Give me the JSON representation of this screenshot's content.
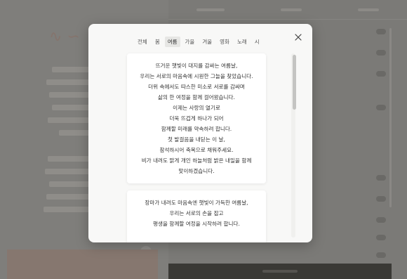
{
  "modal": {
    "tabs": [
      {
        "label": "전체",
        "active": false
      },
      {
        "label": "봄",
        "active": false
      },
      {
        "label": "여름",
        "active": true
      },
      {
        "label": "가을",
        "active": false
      },
      {
        "label": "겨울",
        "active": false
      },
      {
        "label": "영화",
        "active": false
      },
      {
        "label": "노래",
        "active": false
      },
      {
        "label": "시",
        "active": false
      }
    ],
    "cards": [
      {
        "lines": [
          "뜨거운 햇빛이 대지를 감싸는 여름날,",
          "우리는 서로의 마음속에 시원한 그늘을 찾았습니다.",
          "더위 속에서도 따스한 미소로 서로를 감싸며",
          "삶의 한 여정을 함께 걸어왔습니다.",
          "이제는 사랑의 열기로",
          "더욱 뜨겁게 하나가 되어",
          "함께할 미래를 약속하려 합니다.",
          "첫 발걸음을 내딛는 이 날,",
          "참석하시어 축복으로 채워주세요.",
          "비가 내려도 맑게 개인 하늘처럼 밝은 내일을 함께",
          "맞이하겠습니다."
        ]
      },
      {
        "lines": [
          "장마가 내려도 마음속엔 햇빛이 가득한 여름날,",
          "우리는 서로의 손을 잡고",
          "평생을 함께할 여정을 시작하려 합니다."
        ]
      }
    ]
  },
  "colors": {
    "overlay": "#7d7c79",
    "modal_bg": "#f8f8f7",
    "card_bg": "#ffffff",
    "active_tab_bg": "#e6e6e4",
    "footer_bg": "#3a3935"
  },
  "icons": {
    "close": "close-icon"
  }
}
